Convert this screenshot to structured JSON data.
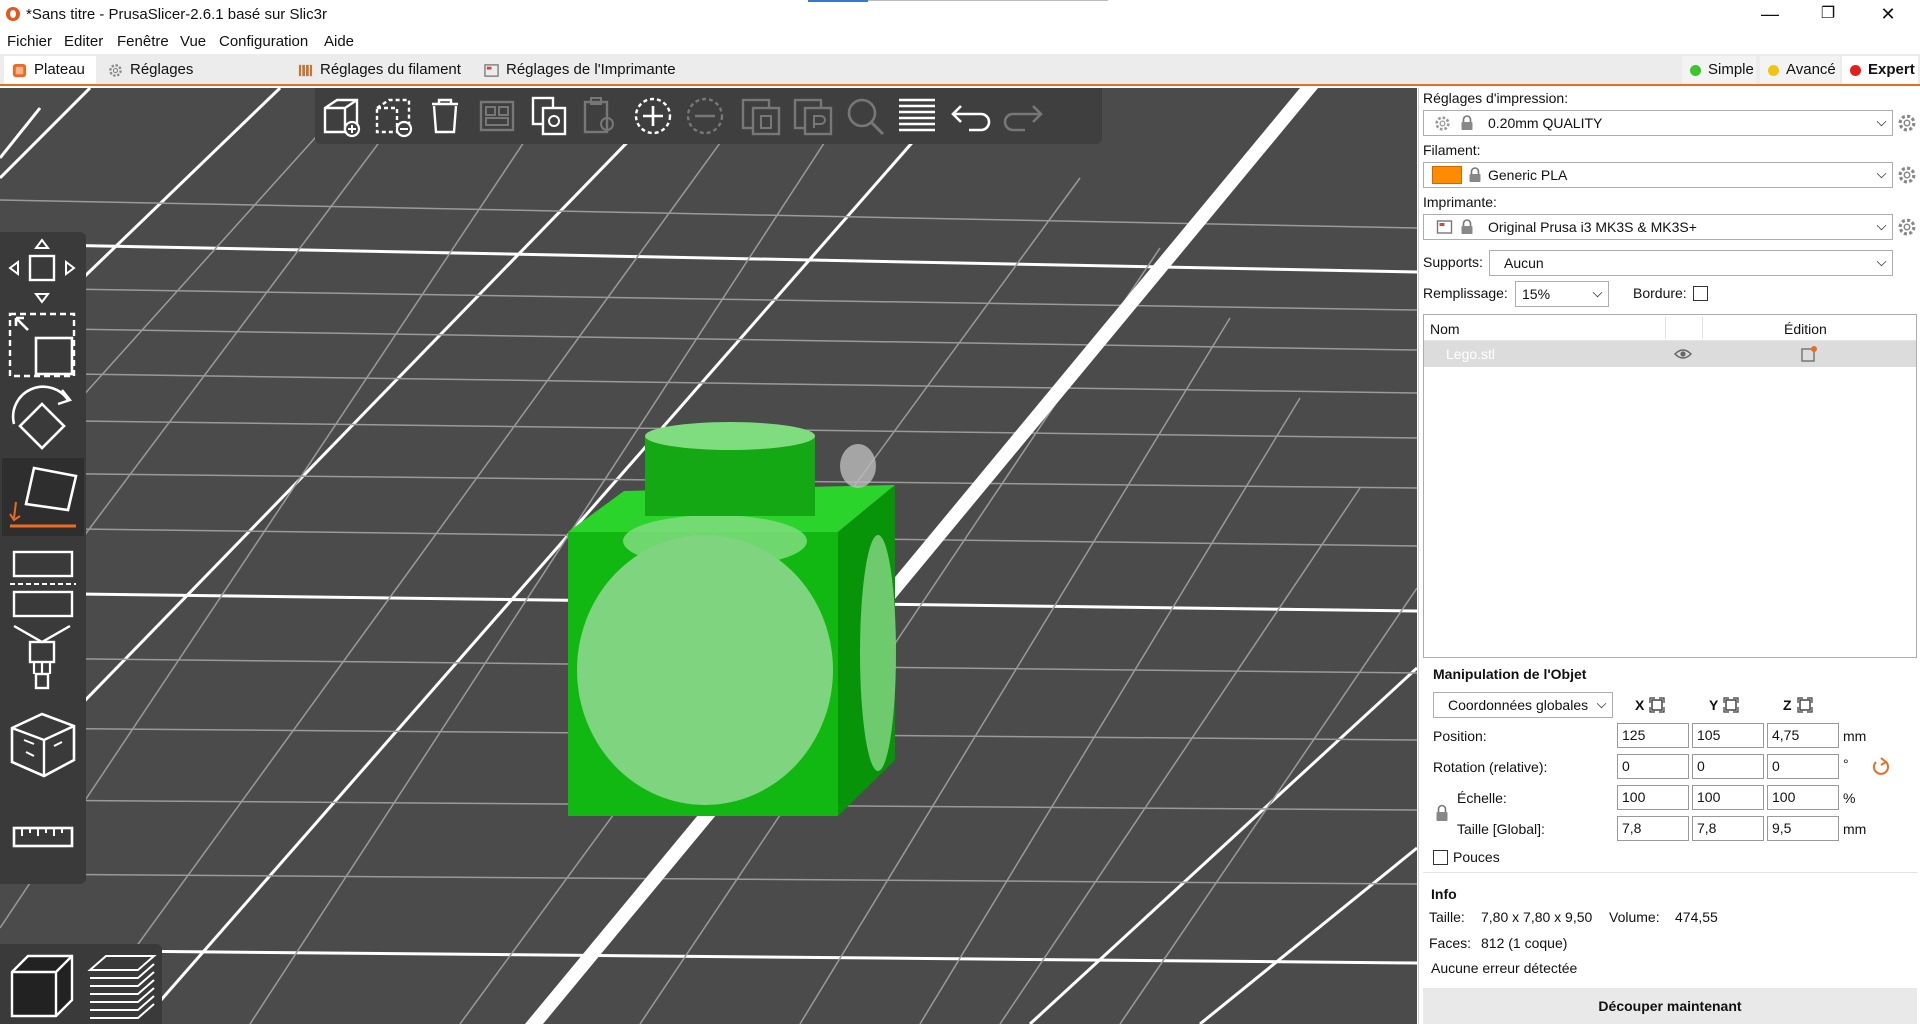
{
  "titlebar": {
    "title": "*Sans titre - PrusaSlicer-2.6.1 basé sur Slic3r",
    "minimize": "—",
    "maximize": "❐",
    "close": "✕"
  },
  "menu": [
    "Fichier",
    "Editer",
    "Fenêtre",
    "Vue",
    "Configuration",
    "Aide"
  ],
  "tabs": [
    {
      "label": "Plateau",
      "icon": "plate-icon",
      "active": true
    },
    {
      "label": "Réglages d'Impression",
      "icon": "gear-icon"
    },
    {
      "label": "Réglages du filament",
      "icon": "filament-spool-icon"
    },
    {
      "label": "Réglages de l'Imprimante",
      "icon": "printer-icon"
    }
  ],
  "modes": [
    {
      "label": "Simple",
      "color": "#3dc62b"
    },
    {
      "label": "Avancé",
      "color": "#f1c40f"
    },
    {
      "label": "Expert",
      "color": "#e61e1e",
      "active": true
    }
  ],
  "colors": {
    "accent": "#ed6b21",
    "bed": "#4b4b4b",
    "toolbar": "#3f3f3f",
    "object": "#1fb81f",
    "filament": "#ff8c00"
  },
  "toolbar_top": [
    "add-icon",
    "delete-icon",
    "delete-all-icon",
    "arrange-icon",
    "copy-icon",
    "paste-icon",
    "add-instance-icon",
    "remove-instance-icon",
    "split-objects-icon",
    "split-parts-icon",
    "search-icon",
    "layers-editing-icon",
    "undo-icon",
    "redo-icon"
  ],
  "toolbar_left": [
    "move-icon",
    "scale-icon",
    "rotate-icon",
    "place-on-face-icon",
    "cut-icon",
    "paint-supports-icon",
    "seam-painting-icon",
    "measure-icon"
  ],
  "sidebar": {
    "print_label": "Réglages d'impression:",
    "print_value": "0.20mm QUALITY",
    "filament_label": "Filament:",
    "filament_value": "Generic PLA",
    "printer_label": "Imprimante:",
    "printer_value": "Original Prusa i3 MK3S & MK3S+",
    "supports_label": "Supports:",
    "supports_value": "Aucun",
    "infill_label": "Remplissage:",
    "infill_value": "15%",
    "brim_label": "Bordure:",
    "brim_checked": false
  },
  "objlist": {
    "col_name": "Nom",
    "col_edit": "Édition",
    "rows": [
      {
        "name": "Lego.stl"
      }
    ]
  },
  "manip": {
    "title": "Manipulation de l'Objet",
    "coords": "Coordonnées globales",
    "x": "X",
    "y": "Y",
    "z": "Z",
    "position_label": "Position:",
    "position": [
      "125",
      "105",
      "4,75"
    ],
    "position_unit": "mm",
    "rotation_label": "Rotation (relative):",
    "rotation": [
      "0",
      "0",
      "0"
    ],
    "rotation_unit": "°",
    "scale_label": "Échelle:",
    "scale": [
      "100",
      "100",
      "100"
    ],
    "scale_unit": "%",
    "size_label": "Taille [Global]:",
    "size": [
      "7,8",
      "7,8",
      "9,5"
    ],
    "size_unit": "mm",
    "inches_label": "Pouces",
    "inches_checked": false
  },
  "info": {
    "title": "Info",
    "size_label": "Taille:",
    "size_value": "7,80 x 7,80 x 9,50",
    "volume_label": "Volume:",
    "volume_value": "474,55",
    "faces_label": "Faces:",
    "faces_value": "812 (1 coque)",
    "errors": "Aucune erreur détectée"
  },
  "slice_button": "Découper maintenant"
}
